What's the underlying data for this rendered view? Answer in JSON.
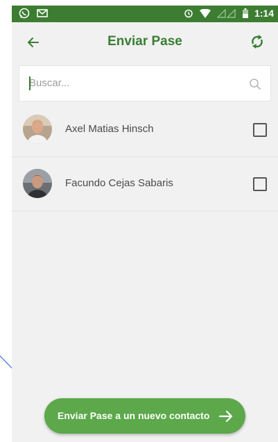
{
  "statusbar": {
    "time": "1:14"
  },
  "appbar": {
    "title": "Enviar Pase"
  },
  "search": {
    "placeholder": "Buscar..."
  },
  "contacts": [
    {
      "name": "Axel Matias Hinsch"
    },
    {
      "name": "Facundo Cejas Sabaris"
    }
  ],
  "fab": {
    "label": "Enviar Pase a un nuevo contacto"
  },
  "colors": {
    "primary": "#3a7d33",
    "statusbar": "#3c7d32",
    "fab": "#5ca84a",
    "annotation": "#3b6fd6"
  }
}
